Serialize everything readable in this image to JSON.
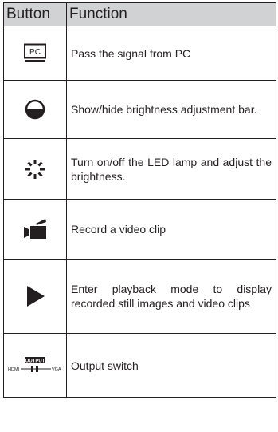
{
  "table": {
    "header": {
      "button": "Button",
      "function": "Function"
    },
    "rows": [
      {
        "icon": "pc-monitor-icon",
        "label": "PC",
        "function": "Pass the signal from PC"
      },
      {
        "icon": "brightness-half-circle-icon",
        "function": "Show/hide brightness adjustment bar."
      },
      {
        "icon": "led-lamp-icon",
        "function": "Turn on/off the LED lamp and adjust the brightness."
      },
      {
        "icon": "video-camera-icon",
        "function": "Record a video clip"
      },
      {
        "icon": "play-icon",
        "function": "Enter playback mode to display recorded still images and video clips"
      },
      {
        "icon": "output-switch-icon",
        "labels": {
          "top": "OUTPUT",
          "left": "HDMI",
          "right": "VGA"
        },
        "function": "Output switch"
      }
    ]
  }
}
